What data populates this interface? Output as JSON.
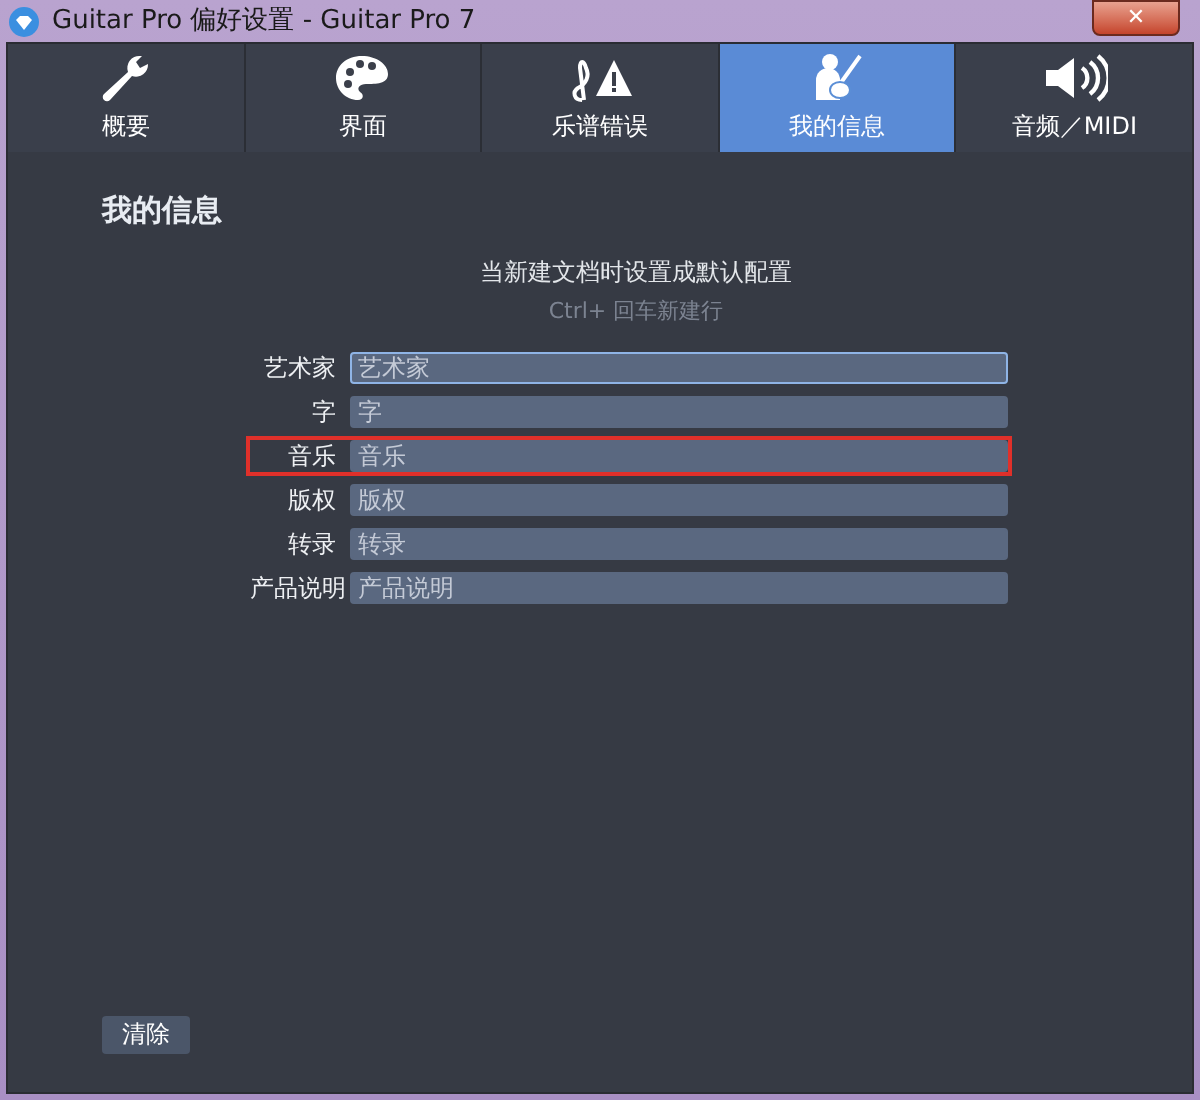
{
  "window": {
    "title": "Guitar Pro 偏好设置 - Guitar Pro 7",
    "close": "✕"
  },
  "tabs": [
    {
      "label": "概要",
      "selected": false
    },
    {
      "label": "界面",
      "selected": false
    },
    {
      "label": "乐谱错误",
      "selected": false
    },
    {
      "label": "我的信息",
      "selected": true
    },
    {
      "label": "音频／MIDI",
      "selected": false
    }
  ],
  "heading": "我的信息",
  "note": "当新建文档时设置成默认配置",
  "hint": "Ctrl+ 回车新建行",
  "fields": [
    {
      "label": "艺术家",
      "placeholder": "艺术家",
      "focused": true,
      "highlighted": false
    },
    {
      "label": "字",
      "placeholder": "字",
      "focused": false,
      "highlighted": false
    },
    {
      "label": "音乐",
      "placeholder": "音乐",
      "focused": false,
      "highlighted": true
    },
    {
      "label": "版权",
      "placeholder": "版权",
      "focused": false,
      "highlighted": false
    },
    {
      "label": "转录",
      "placeholder": "转录",
      "focused": false,
      "highlighted": false
    },
    {
      "label": "产品说明",
      "placeholder": "产品说明",
      "focused": false,
      "highlighted": false
    }
  ],
  "clear_button": "清除"
}
